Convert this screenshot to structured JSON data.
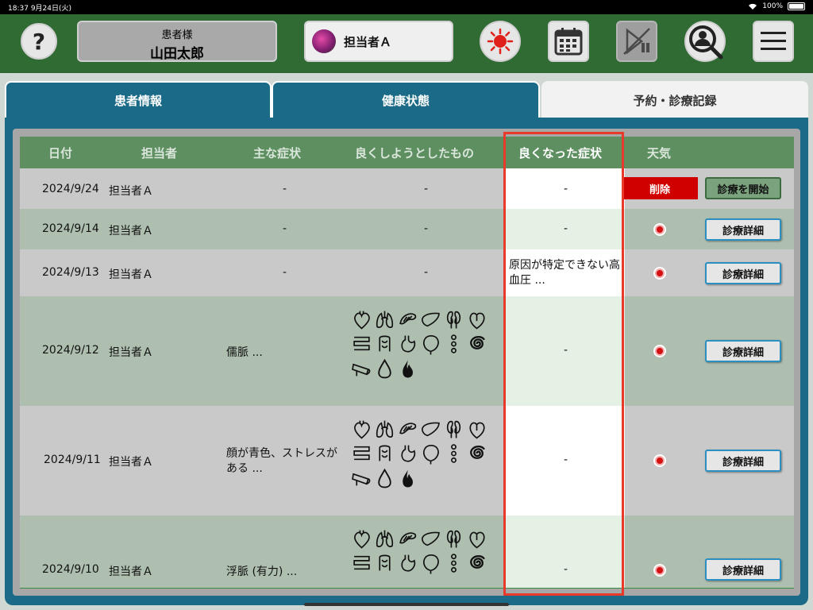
{
  "status_bar": {
    "time": "18:37",
    "date": "9月24日(火)",
    "wifi": "wifi-icon",
    "battery": "100%"
  },
  "header": {
    "help_label": "?",
    "patient_label": "患者様",
    "patient_name": "山田太郎",
    "staff_name": "担当者Ａ",
    "icons": [
      "help-icon",
      "sun-icon",
      "calendar-icon",
      "play-pause-icon",
      "person-search-icon",
      "menu-icon"
    ]
  },
  "tabs": [
    {
      "label": "患者情報"
    },
    {
      "label": "健康状態"
    },
    {
      "label": "予約・診療記録"
    }
  ],
  "table": {
    "headers": [
      "日付",
      "担当者",
      "主な症状",
      "良くしようとしたもの",
      "良くなった症状",
      "天気"
    ],
    "rows": [
      {
        "date": "2024/9/24",
        "staff": "担当者Ａ",
        "symptom": "-",
        "target": "-",
        "improved": "-",
        "weather": "",
        "actions": [
          "削除",
          "診療を開始"
        ]
      },
      {
        "date": "2024/9/14",
        "staff": "担当者Ａ",
        "symptom": "-",
        "target": "-",
        "improved": "-",
        "weather": "sun-icon",
        "actions": [
          "診療詳細"
        ]
      },
      {
        "date": "2024/9/13",
        "staff": "担当者Ａ",
        "symptom": "-",
        "target": "-",
        "improved": "原因が特定できない高血圧 ...",
        "weather": "sun-icon",
        "actions": [
          "診療詳細"
        ]
      },
      {
        "date": "2024/9/12",
        "staff": "担当者Ａ",
        "symptom": "儒脈 ...",
        "target": "organ-icons",
        "improved": "-",
        "weather": "sun-icon",
        "actions": [
          "診療詳細"
        ]
      },
      {
        "date": "2024/9/11",
        "staff": "担当者Ａ",
        "symptom": "顔が青色、ストレスがある ...",
        "target": "organ-icons",
        "improved": "-",
        "weather": "sun-icon",
        "actions": [
          "診療詳細"
        ]
      },
      {
        "date": "2024/9/10",
        "staff": "担当者Ａ",
        "symptom": "浮脈 (有力) ...",
        "target": "organ-icons",
        "improved": "-",
        "weather": "sun-icon",
        "actions": [
          "診療詳細"
        ]
      }
    ]
  },
  "colors": {
    "header_bg": "#2f6b33",
    "tab_bg": "#1b6a87",
    "highlight_frame": "#e8392a",
    "delete": "#d10000"
  }
}
